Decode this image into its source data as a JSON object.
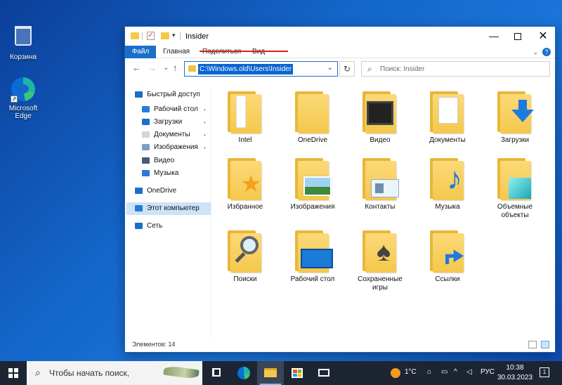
{
  "desktop": {
    "recycle_bin": "Корзина",
    "edge": "Microsoft Edge"
  },
  "window": {
    "title": "Insider",
    "controls": {
      "minimize": "—",
      "maximize": "",
      "close": "✕"
    }
  },
  "ribbon": {
    "tabs": [
      "Файл",
      "Главная",
      "Поделиться",
      "Вид"
    ],
    "expand": "⌄",
    "help": "?"
  },
  "navigation": {
    "back": "←",
    "forward": "→",
    "recent": "⌄",
    "up": "↑",
    "address": "C:\\Windows.old\\Users\\Insider",
    "refresh": "↻",
    "search_placeholder": "Поиск: Insider"
  },
  "sidebar": {
    "items": [
      {
        "label": "Быстрый доступ",
        "icon": "star-icon"
      },
      {
        "label": "Рабочий стол",
        "icon": "desktop-icon",
        "pinned": true
      },
      {
        "label": "Загрузки",
        "icon": "download-icon",
        "pinned": true
      },
      {
        "label": "Документы",
        "icon": "documents-icon",
        "pinned": true
      },
      {
        "label": "Изображения",
        "icon": "pictures-icon",
        "pinned": true
      },
      {
        "label": "Видео",
        "icon": "video-icon"
      },
      {
        "label": "Музыка",
        "icon": "music-icon"
      },
      {
        "label": "OneDrive",
        "icon": "cloud-icon"
      },
      {
        "label": "Этот компьютер",
        "icon": "computer-icon",
        "selected": true
      },
      {
        "label": "Сеть",
        "icon": "network-icon"
      }
    ],
    "pin_glyph": "📌"
  },
  "folders": [
    {
      "label": "Intel",
      "icon": "folder-intel-icon"
    },
    {
      "label": "OneDrive",
      "icon": "folder-onedrive-icon"
    },
    {
      "label": "Видео",
      "icon": "folder-video-icon"
    },
    {
      "label": "Документы",
      "icon": "folder-documents-icon"
    },
    {
      "label": "Загрузки",
      "icon": "folder-downloads-icon"
    },
    {
      "label": "Избранное",
      "icon": "folder-favorites-icon"
    },
    {
      "label": "Изображения",
      "icon": "folder-pictures-icon"
    },
    {
      "label": "Контакты",
      "icon": "folder-contacts-icon"
    },
    {
      "label": "Музыка",
      "icon": "folder-music-icon"
    },
    {
      "label": "Объемные объекты",
      "icon": "folder-3d-icon"
    },
    {
      "label": "Поиски",
      "icon": "folder-searches-icon"
    },
    {
      "label": "Рабочий стол",
      "icon": "folder-desktop-icon"
    },
    {
      "label": "Сохраненные игры",
      "icon": "folder-games-icon"
    },
    {
      "label": "Ссылки",
      "icon": "folder-links-icon"
    }
  ],
  "status": {
    "item_count": "Элементов: 14"
  },
  "taskbar": {
    "search_placeholder": "Чтобы начать поиск,",
    "weather": "1°C",
    "language": "РУС",
    "time": "10:38",
    "date": "30.03.2023",
    "notifications": "1"
  },
  "colors": {
    "accent": "#1a6fc9",
    "folder": "#f4c84c",
    "selection": "#cde3f8",
    "taskbar": "#1d2532"
  }
}
